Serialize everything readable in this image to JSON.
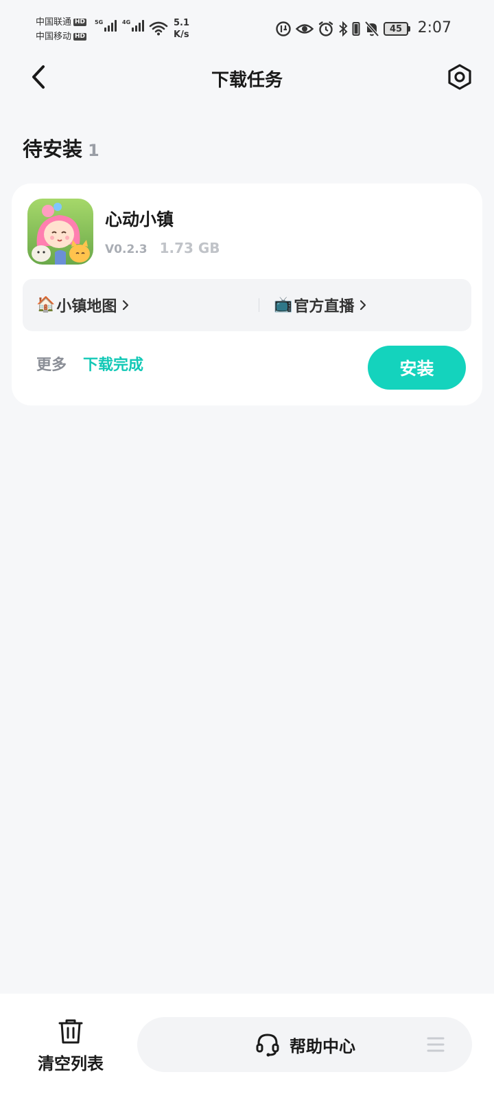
{
  "status_bar": {
    "carrier_1": "中国联通",
    "carrier_2": "中国移动",
    "hd_badge": "HD",
    "signal_1_tag": "5G",
    "signal_2_tag": "4G",
    "net_speed_value": "5.1",
    "net_speed_unit": "K/s",
    "battery_level": "45",
    "time": "2:07"
  },
  "header": {
    "title": "下载任务"
  },
  "section": {
    "label": "待安装",
    "count": "1"
  },
  "download_item": {
    "app_name": "心动小镇",
    "version": "V0.2.3",
    "size": "1.73 GB",
    "links": [
      {
        "emoji": "🏠",
        "label": "小镇地图"
      },
      {
        "emoji": "📺",
        "label": "官方直播"
      }
    ],
    "more_label": "更多",
    "status_label": "下载完成",
    "install_label": "安装"
  },
  "bottom_bar": {
    "clear_label": "清空列表",
    "help_label": "帮助中心"
  },
  "colors": {
    "accent": "#14d3bd",
    "status_text": "#12c8b6",
    "background": "#f6f7f9"
  },
  "icons": [
    "back-arrow-icon",
    "settings-icon",
    "trash-icon",
    "headset-icon",
    "menu-icon",
    "home-icon",
    "tv-icon"
  ]
}
